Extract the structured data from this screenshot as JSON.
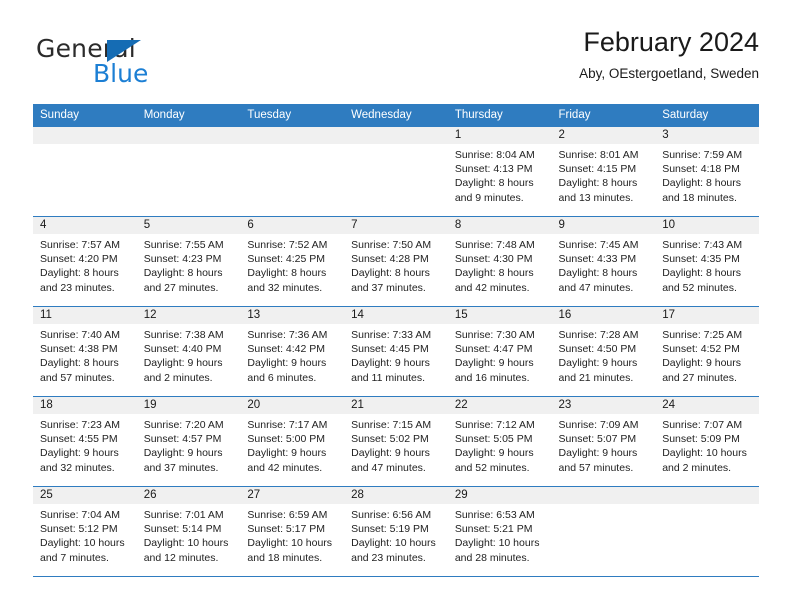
{
  "brand": {
    "name_top": "General",
    "name_bottom": "Blue",
    "triangle_color": "#156cb4",
    "blue_color": "#1c7fd4"
  },
  "header": {
    "title": "February 2024",
    "subtitle": "Aby, OEstergoetland, Sweden"
  },
  "theme": {
    "header_row_bg": "#2f7cc0",
    "daynum_band_bg": "#f0f0f0",
    "row_divider": "#2f7cc0"
  },
  "columns": [
    "Sunday",
    "Monday",
    "Tuesday",
    "Wednesday",
    "Thursday",
    "Friday",
    "Saturday"
  ],
  "weeks": [
    [
      {
        "day": "",
        "empty": true
      },
      {
        "day": "",
        "empty": true
      },
      {
        "day": "",
        "empty": true
      },
      {
        "day": "",
        "empty": true
      },
      {
        "day": "1",
        "sunrise": "Sunrise: 8:04 AM",
        "sunset": "Sunset: 4:13 PM",
        "daylight": "Daylight: 8 hours and 9 minutes."
      },
      {
        "day": "2",
        "sunrise": "Sunrise: 8:01 AM",
        "sunset": "Sunset: 4:15 PM",
        "daylight": "Daylight: 8 hours and 13 minutes."
      },
      {
        "day": "3",
        "sunrise": "Sunrise: 7:59 AM",
        "sunset": "Sunset: 4:18 PM",
        "daylight": "Daylight: 8 hours and 18 minutes."
      }
    ],
    [
      {
        "day": "4",
        "sunrise": "Sunrise: 7:57 AM",
        "sunset": "Sunset: 4:20 PM",
        "daylight": "Daylight: 8 hours and 23 minutes."
      },
      {
        "day": "5",
        "sunrise": "Sunrise: 7:55 AM",
        "sunset": "Sunset: 4:23 PM",
        "daylight": "Daylight: 8 hours and 27 minutes."
      },
      {
        "day": "6",
        "sunrise": "Sunrise: 7:52 AM",
        "sunset": "Sunset: 4:25 PM",
        "daylight": "Daylight: 8 hours and 32 minutes."
      },
      {
        "day": "7",
        "sunrise": "Sunrise: 7:50 AM",
        "sunset": "Sunset: 4:28 PM",
        "daylight": "Daylight: 8 hours and 37 minutes."
      },
      {
        "day": "8",
        "sunrise": "Sunrise: 7:48 AM",
        "sunset": "Sunset: 4:30 PM",
        "daylight": "Daylight: 8 hours and 42 minutes."
      },
      {
        "day": "9",
        "sunrise": "Sunrise: 7:45 AM",
        "sunset": "Sunset: 4:33 PM",
        "daylight": "Daylight: 8 hours and 47 minutes."
      },
      {
        "day": "10",
        "sunrise": "Sunrise: 7:43 AM",
        "sunset": "Sunset: 4:35 PM",
        "daylight": "Daylight: 8 hours and 52 minutes."
      }
    ],
    [
      {
        "day": "11",
        "sunrise": "Sunrise: 7:40 AM",
        "sunset": "Sunset: 4:38 PM",
        "daylight": "Daylight: 8 hours and 57 minutes."
      },
      {
        "day": "12",
        "sunrise": "Sunrise: 7:38 AM",
        "sunset": "Sunset: 4:40 PM",
        "daylight": "Daylight: 9 hours and 2 minutes."
      },
      {
        "day": "13",
        "sunrise": "Sunrise: 7:36 AM",
        "sunset": "Sunset: 4:42 PM",
        "daylight": "Daylight: 9 hours and 6 minutes."
      },
      {
        "day": "14",
        "sunrise": "Sunrise: 7:33 AM",
        "sunset": "Sunset: 4:45 PM",
        "daylight": "Daylight: 9 hours and 11 minutes."
      },
      {
        "day": "15",
        "sunrise": "Sunrise: 7:30 AM",
        "sunset": "Sunset: 4:47 PM",
        "daylight": "Daylight: 9 hours and 16 minutes."
      },
      {
        "day": "16",
        "sunrise": "Sunrise: 7:28 AM",
        "sunset": "Sunset: 4:50 PM",
        "daylight": "Daylight: 9 hours and 21 minutes."
      },
      {
        "day": "17",
        "sunrise": "Sunrise: 7:25 AM",
        "sunset": "Sunset: 4:52 PM",
        "daylight": "Daylight: 9 hours and 27 minutes."
      }
    ],
    [
      {
        "day": "18",
        "sunrise": "Sunrise: 7:23 AM",
        "sunset": "Sunset: 4:55 PM",
        "daylight": "Daylight: 9 hours and 32 minutes."
      },
      {
        "day": "19",
        "sunrise": "Sunrise: 7:20 AM",
        "sunset": "Sunset: 4:57 PM",
        "daylight": "Daylight: 9 hours and 37 minutes."
      },
      {
        "day": "20",
        "sunrise": "Sunrise: 7:17 AM",
        "sunset": "Sunset: 5:00 PM",
        "daylight": "Daylight: 9 hours and 42 minutes."
      },
      {
        "day": "21",
        "sunrise": "Sunrise: 7:15 AM",
        "sunset": "Sunset: 5:02 PM",
        "daylight": "Daylight: 9 hours and 47 minutes."
      },
      {
        "day": "22",
        "sunrise": "Sunrise: 7:12 AM",
        "sunset": "Sunset: 5:05 PM",
        "daylight": "Daylight: 9 hours and 52 minutes."
      },
      {
        "day": "23",
        "sunrise": "Sunrise: 7:09 AM",
        "sunset": "Sunset: 5:07 PM",
        "daylight": "Daylight: 9 hours and 57 minutes."
      },
      {
        "day": "24",
        "sunrise": "Sunrise: 7:07 AM",
        "sunset": "Sunset: 5:09 PM",
        "daylight": "Daylight: 10 hours and 2 minutes."
      }
    ],
    [
      {
        "day": "25",
        "sunrise": "Sunrise: 7:04 AM",
        "sunset": "Sunset: 5:12 PM",
        "daylight": "Daylight: 10 hours and 7 minutes."
      },
      {
        "day": "26",
        "sunrise": "Sunrise: 7:01 AM",
        "sunset": "Sunset: 5:14 PM",
        "daylight": "Daylight: 10 hours and 12 minutes."
      },
      {
        "day": "27",
        "sunrise": "Sunrise: 6:59 AM",
        "sunset": "Sunset: 5:17 PM",
        "daylight": "Daylight: 10 hours and 18 minutes."
      },
      {
        "day": "28",
        "sunrise": "Sunrise: 6:56 AM",
        "sunset": "Sunset: 5:19 PM",
        "daylight": "Daylight: 10 hours and 23 minutes."
      },
      {
        "day": "29",
        "sunrise": "Sunrise: 6:53 AM",
        "sunset": "Sunset: 5:21 PM",
        "daylight": "Daylight: 10 hours and 28 minutes."
      },
      {
        "day": "",
        "empty": true
      },
      {
        "day": "",
        "empty": true
      }
    ]
  ]
}
